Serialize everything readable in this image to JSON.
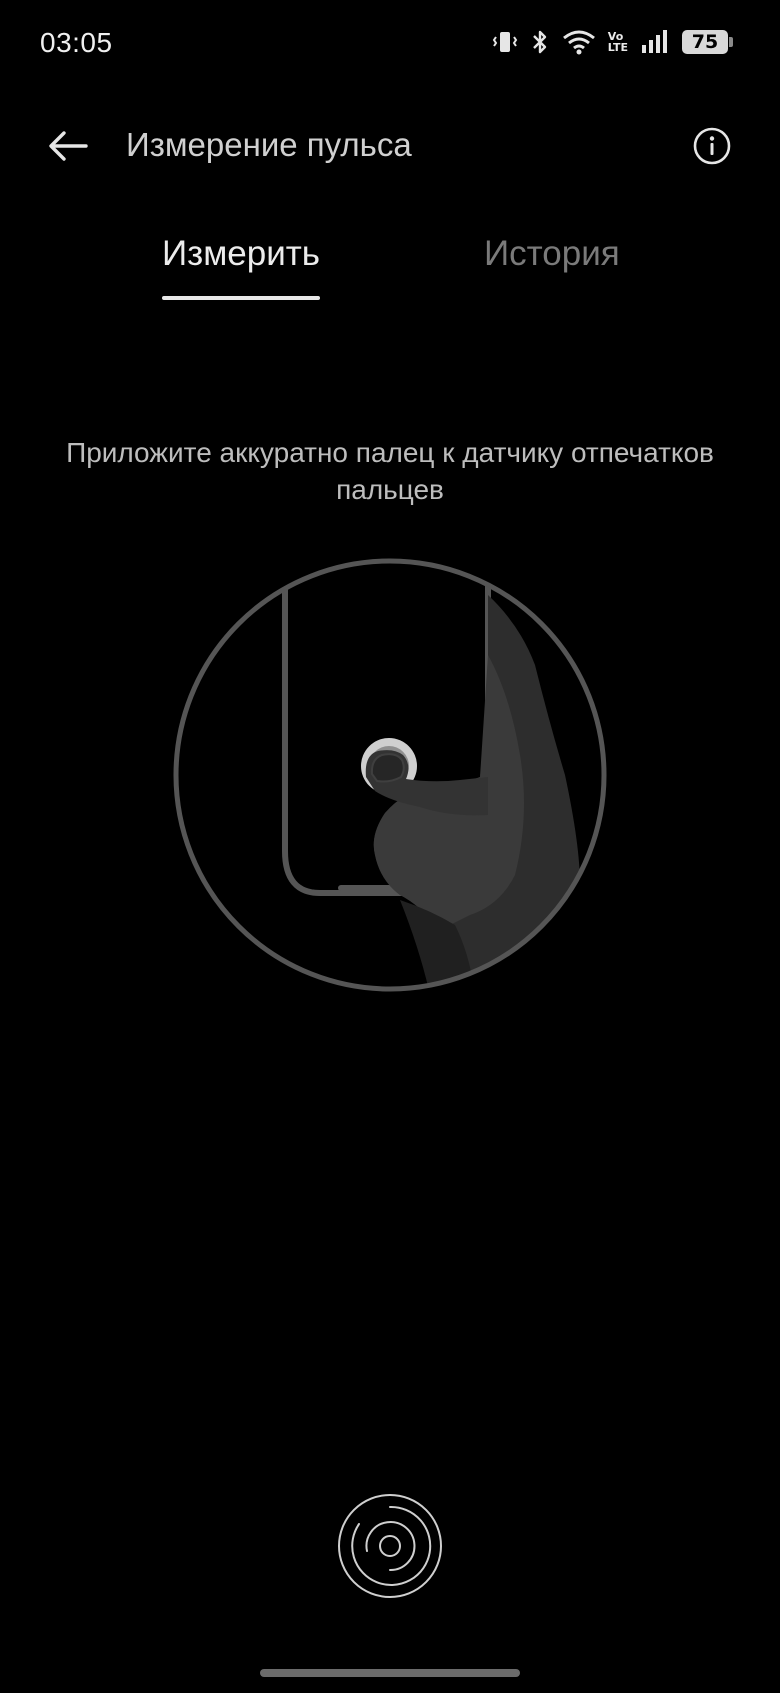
{
  "status_bar": {
    "time": "03:05",
    "network_label_top": "Vo",
    "network_label_bottom": "LTE",
    "battery": "75",
    "icons": [
      "vibrate-icon",
      "bluetooth-icon",
      "wifi-icon",
      "volte-icon",
      "signal-icon",
      "battery-icon"
    ]
  },
  "app_bar": {
    "title": "Измерение пульса",
    "back_icon": "arrow-left-icon",
    "info_icon": "info-icon"
  },
  "tabs": [
    {
      "label": "Измерить",
      "selected": true
    },
    {
      "label": "История",
      "selected": false
    }
  ],
  "main": {
    "instruction": "Приложите аккуратно палец к датчику отпечатков пальцев",
    "illustration_icon": "phone-finger-sensor-illustration",
    "sensor_icon": "fingerprint-sensor-icon"
  },
  "colors": {
    "background": "#000000",
    "text_primary": "#ececec",
    "text_secondary": "#7a7a7a",
    "illustration_stroke": "#5a5a5a",
    "hand_fill": "#2f2f2f"
  }
}
